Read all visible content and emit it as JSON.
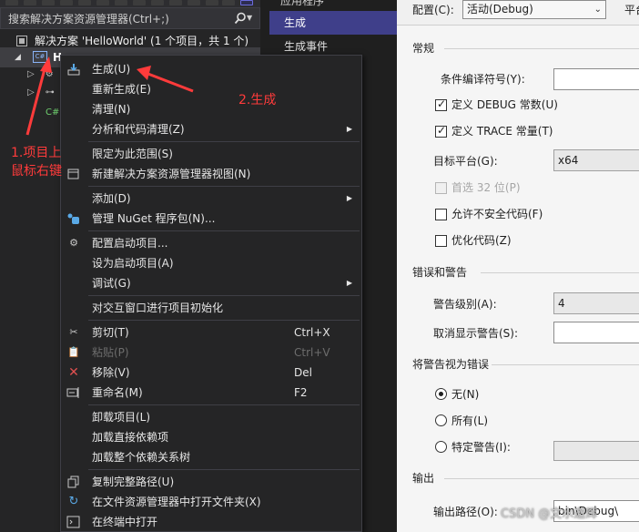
{
  "solution_explorer": {
    "search_placeholder": "搜索解决方案资源管理器(Ctrl+;)",
    "solution_label": "解决方案 'HelloWorld' (1 个项目，共 1 个)",
    "project_label": "H",
    "project_icon_text": "C#"
  },
  "project_tabs": {
    "top_partial": "应用程序",
    "build": "生成",
    "build_events": "生成事件"
  },
  "properties": {
    "config_label": "配置(C):",
    "config_value": "活动(Debug)",
    "platform_label": "平台",
    "general_title": "常规",
    "conditional_symbols_label": "条件编译符号(Y):",
    "conditional_symbols_value": "",
    "define_debug_label": "定义 DEBUG 常数(U)",
    "define_debug_checked": true,
    "define_trace_label": "定义 TRACE 常量(T)",
    "define_trace_checked": true,
    "target_platform_label": "目标平台(G):",
    "target_platform_value": "x64",
    "prefer32_label": "首选 32 位(P)",
    "prefer32_checked": false,
    "allow_unsafe_label": "允许不安全代码(F)",
    "allow_unsafe_checked": false,
    "optimize_label": "优化代码(Z)",
    "optimize_checked": false,
    "errors_title": "错误和警告",
    "warning_level_label": "警告级别(A):",
    "warning_level_value": "4",
    "suppress_label": "取消显示警告(S):",
    "suppress_value": "",
    "treat_title": "将警告视为错误",
    "radio_none_label": "无(N)",
    "radio_all_label": "所有(L)",
    "radio_specific_label": "特定警告(I):",
    "radio_selected": "none",
    "output_title": "输出",
    "output_path_label": "输出路径(O):",
    "output_path_value": "bin\\Debug\\"
  },
  "context_menu": {
    "items": [
      {
        "label": "生成(U)",
        "icon": "build-icon"
      },
      {
        "label": "重新生成(E)"
      },
      {
        "label": "清理(N)"
      },
      {
        "label": "分析和代码清理(Z)",
        "submenu": true
      },
      {
        "label": "限定为此范围(S)"
      },
      {
        "label": "新建解决方案资源管理器视图(N)",
        "icon": "new-view-icon"
      },
      {
        "label": "添加(D)",
        "submenu": true
      },
      {
        "label": "管理 NuGet 程序包(N)...",
        "icon": "nuget-icon"
      },
      {
        "label": "配置启动项目...",
        "icon": "gear-icon"
      },
      {
        "label": "设为启动项目(A)"
      },
      {
        "label": "调试(G)",
        "submenu": true
      },
      {
        "label": "对交互窗口进行项目初始化"
      },
      {
        "label": "剪切(T)",
        "shortcut": "Ctrl+X",
        "icon": "scissors-icon"
      },
      {
        "label": "粘贴(P)",
        "shortcut": "Ctrl+V",
        "icon": "paste-icon",
        "disabled": true
      },
      {
        "label": "移除(V)",
        "shortcut": "Del",
        "icon": "remove-icon"
      },
      {
        "label": "重命名(M)",
        "shortcut": "F2",
        "icon": "rename-icon"
      },
      {
        "label": "卸载项目(L)"
      },
      {
        "label": "加载直接依赖项"
      },
      {
        "label": "加载整个依赖关系树"
      },
      {
        "label": "复制完整路径(U)",
        "icon": "copy-icon"
      },
      {
        "label": "在文件资源管理器中打开文件夹(X)",
        "icon": "refresh-folder-icon"
      },
      {
        "label": "在终端中打开",
        "icon": "terminal-icon"
      }
    ]
  },
  "annotations": {
    "step1_line1": "1.项目上",
    "step1_line2": "鼠标右键",
    "step2": "2.生成",
    "color": "#ff3b3b"
  },
  "watermark": "CSDN @文水邀辉",
  "colors": {
    "menu_bg": "#252526",
    "tab_active": "#3f3f8a",
    "panel_bg": "#f5f5f5"
  }
}
